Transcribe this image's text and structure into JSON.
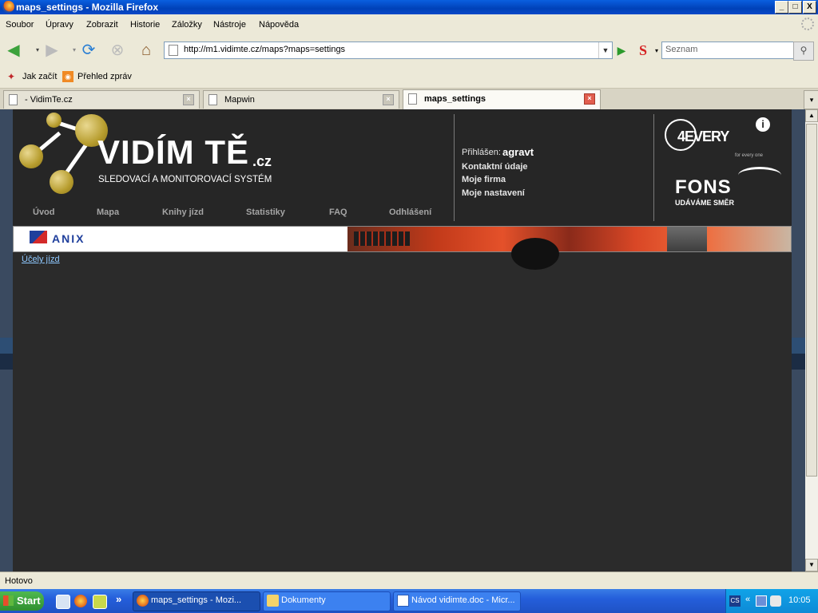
{
  "window": {
    "title": "maps_settings - Mozilla Firefox",
    "min": "_",
    "max": "□",
    "close": "X"
  },
  "menu": [
    "Soubor",
    "Úpravy",
    "Zobrazit",
    "Historie",
    "Záložky",
    "Nástroje",
    "Nápověda"
  ],
  "nav": {
    "url": "http://m1.vidimte.cz/maps?maps=settings",
    "search_placeholder": "Seznam"
  },
  "bookmarks": [
    "Jak začít",
    "Přehled zpráv"
  ],
  "tabs": [
    {
      "label": " - VidimTe.cz",
      "active": false
    },
    {
      "label": "Mapwin",
      "active": false
    },
    {
      "label": "maps_settings",
      "active": true
    }
  ],
  "site": {
    "logo_title": "VIDÍM TĚ",
    "logo_domain": ".cz",
    "logo_subtitle": "SLEDOVACÍ A MONITOROVACÍ SYSTÉM",
    "nav": [
      "Úvod",
      "Mapa",
      "Knihy jízd",
      "Statistiky",
      "FAQ",
      "Odhlášení"
    ],
    "logged_in_label": "Přihlášen:",
    "username": "agravt",
    "user_menu": [
      "Kontaktní údaje",
      "Moje firma",
      "Moje nastavení"
    ],
    "partner1": "4EVERY",
    "partner1_tag": "for every one",
    "partner2": "FONS",
    "partner2_tag": "UDÁVÁME SMĚR",
    "banner_brand": "ANIX",
    "content_link": "Účely jízd"
  },
  "status": "Hotovo",
  "taskbar": {
    "start": "Start",
    "more": "»",
    "tasks": [
      {
        "label": "maps_settings - Mozi...",
        "active": true
      },
      {
        "label": "Dokumenty",
        "active": false
      },
      {
        "label": "Návod vidimte.doc - Micr...",
        "active": false
      }
    ],
    "lang": "CS",
    "clock": "10:05"
  },
  "colors": {
    "accent_gold": "#b79d2e",
    "page_bg": "#2b2b2b",
    "link": "#8ec8ff"
  }
}
